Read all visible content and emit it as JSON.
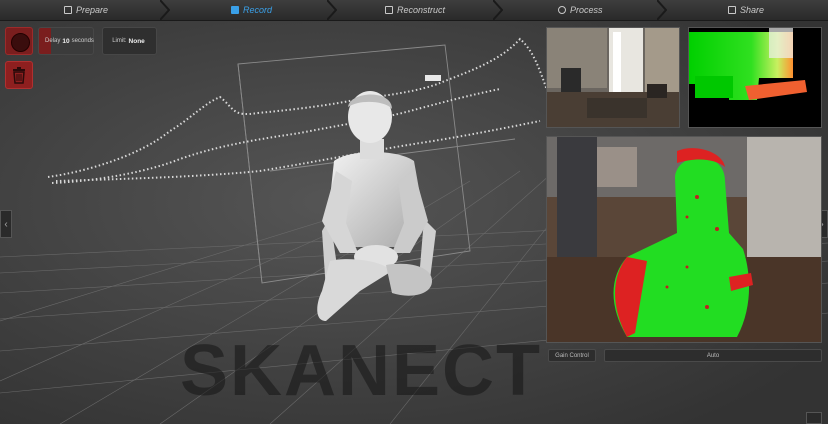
{
  "nav": {
    "tabs": [
      {
        "label": "Prepare"
      },
      {
        "label": "Record"
      },
      {
        "label": "Reconstruct"
      },
      {
        "label": "Process"
      },
      {
        "label": "Share"
      }
    ],
    "active_color": "#3aa0e8"
  },
  "controls": {
    "delay_prefix": "Delay",
    "delay_value": "10",
    "delay_suffix": "seconds",
    "limit_prefix": "Limit",
    "limit_value": "None"
  },
  "panels": {
    "gain_label": "Gain Control",
    "gain_value": "Auto"
  },
  "watermark": "SKANECT",
  "colors": {
    "record": "#7a1e1e",
    "delete": "#8e1f1f",
    "fit_good": "#22dd22",
    "fit_bad": "#dd2222"
  }
}
